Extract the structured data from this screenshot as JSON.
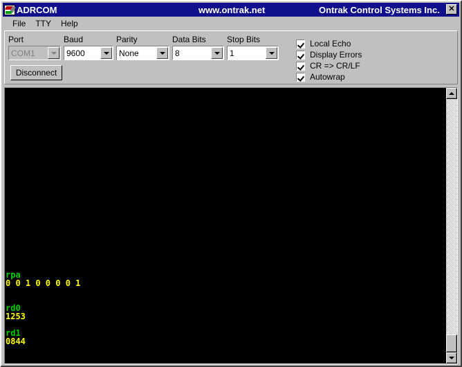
{
  "window": {
    "title": "ADRCOM",
    "url_banner": "www.ontrak.net",
    "company_banner": "Ontrak Control Systems Inc.",
    "close_label": "✕",
    "icon": "adrcom-app-icon",
    "titlebar_color": "#10108c"
  },
  "menubar": {
    "items": [
      {
        "label": "File"
      },
      {
        "label": "TTY"
      },
      {
        "label": "Help"
      }
    ]
  },
  "settings": {
    "fields": [
      {
        "label": "Port",
        "value": "COM1",
        "disabled": true
      },
      {
        "label": "Baud",
        "value": "9600",
        "disabled": false
      },
      {
        "label": "Parity",
        "value": "None",
        "disabled": false
      },
      {
        "label": "Data Bits",
        "value": "8",
        "disabled": false
      },
      {
        "label": "Stop Bits",
        "value": "1",
        "disabled": false
      }
    ],
    "connect_button": "Disconnect",
    "checkboxes": [
      {
        "label": "Local Echo",
        "checked": true
      },
      {
        "label": "Display Errors",
        "checked": true
      },
      {
        "label": "CR => CR/LF",
        "checked": true
      },
      {
        "label": "Autowrap",
        "checked": true
      }
    ]
  },
  "terminal": {
    "background": "#000000",
    "echo_color": "#00d000",
    "response_color": "#ffff00",
    "lines": [
      {
        "text": "rpa",
        "kind": "echo"
      },
      {
        "text": "0 0 1 0 0 0 0 1",
        "kind": "resp"
      },
      {
        "text": "",
        "kind": "blank"
      },
      {
        "text": "",
        "kind": "blank"
      },
      {
        "text": "rd0",
        "kind": "echo"
      },
      {
        "text": "1253",
        "kind": "resp"
      },
      {
        "text": "",
        "kind": "blank"
      },
      {
        "text": "rd1",
        "kind": "echo"
      },
      {
        "text": "0844",
        "kind": "resp"
      },
      {
        "text": "",
        "kind": "blank"
      },
      {
        "text": "",
        "kind": "blank"
      }
    ]
  },
  "scrollbar": {
    "up_arrow": "scroll-up",
    "down_arrow": "scroll-down",
    "thumb": "scroll-thumb"
  }
}
